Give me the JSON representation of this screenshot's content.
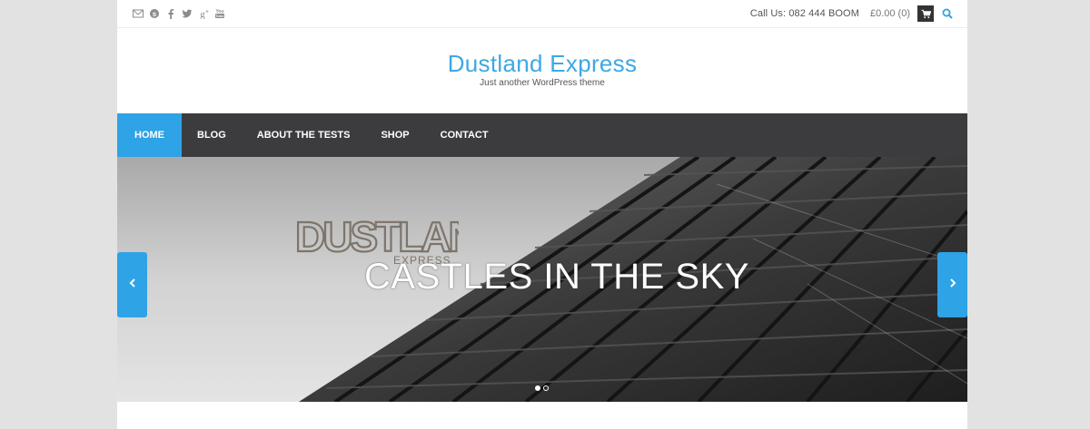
{
  "topbar": {
    "social_icons": [
      "email-icon",
      "skype-icon",
      "facebook-icon",
      "twitter-icon",
      "google-plus-icon",
      "youtube-icon"
    ],
    "call_us": "Call Us: 082 444 BOOM",
    "cart_total": "£0.00 (0)",
    "cart_icon": "cart-icon",
    "search_icon": "search-icon"
  },
  "header": {
    "title": "Dustland Express",
    "tagline": "Just another WordPress theme"
  },
  "nav": {
    "items": [
      {
        "label": "HOME",
        "active": true
      },
      {
        "label": "BLOG",
        "active": false
      },
      {
        "label": "ABOUT THE TESTS",
        "active": false
      },
      {
        "label": "SHOP",
        "active": false
      },
      {
        "label": "CONTACT",
        "active": false
      }
    ]
  },
  "slider": {
    "logo_text": "DUSTLAND EXPRESS",
    "slide_title": "CASTLES IN THE SKY",
    "slide_count": 2,
    "active_slide": 1
  },
  "colors": {
    "accent": "#2ea3e6",
    "title": "#3fa7e4",
    "nav_bg": "#3c3c3e",
    "page_bg": "#e2e2e2"
  }
}
